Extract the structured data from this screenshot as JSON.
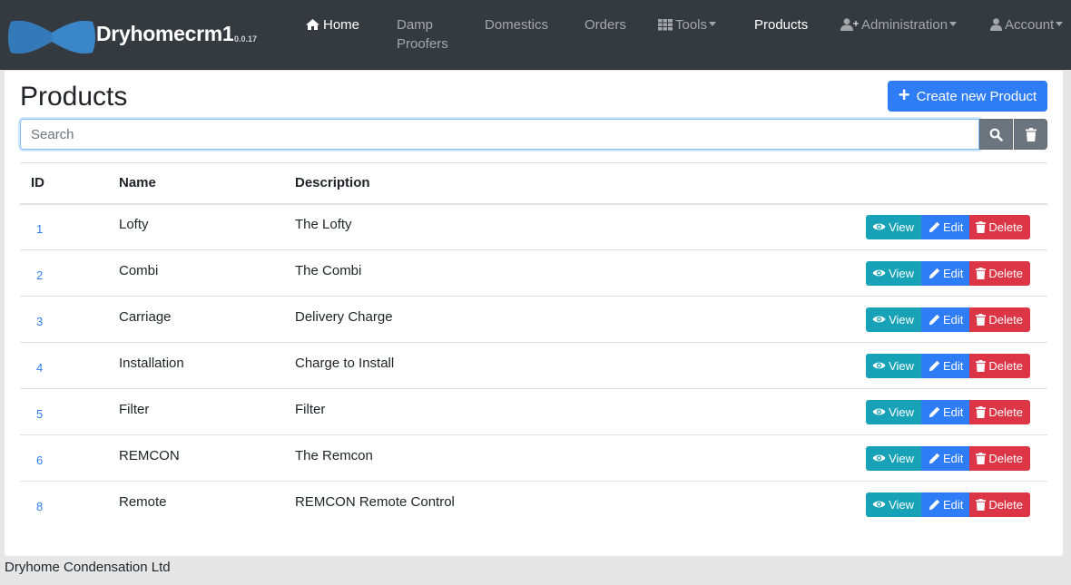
{
  "navbar": {
    "brand_name": "Dryhomecrm1",
    "brand_version": "0.0.17",
    "items": [
      {
        "label": "Home",
        "icon": "home-icon",
        "active": true
      },
      {
        "label": "Damp Proofers"
      },
      {
        "label": "Domestics"
      },
      {
        "label": "Orders"
      },
      {
        "label": "Tools",
        "icon": "table-icon",
        "dropdown": true
      },
      {
        "label": "Products",
        "active": true
      },
      {
        "label": "Administration",
        "icon": "user-plus-icon",
        "dropdown": true
      },
      {
        "label": "Account",
        "icon": "user-icon",
        "dropdown": true
      }
    ],
    "damp_line1": "Damp",
    "damp_line2": "Proofers"
  },
  "page": {
    "title": "Products",
    "create_label": "Create new Product",
    "search_placeholder": "Search"
  },
  "table": {
    "headers": [
      "ID",
      "Name",
      "Description",
      ""
    ],
    "rows": [
      {
        "id": "1",
        "name": "Lofty",
        "description": "The Lofty"
      },
      {
        "id": "2",
        "name": "Combi",
        "description": "The Combi"
      },
      {
        "id": "3",
        "name": "Carriage",
        "description": "Delivery Charge"
      },
      {
        "id": "4",
        "name": "Installation",
        "description": "Charge to Install"
      },
      {
        "id": "5",
        "name": "Filter",
        "description": "Filter"
      },
      {
        "id": "6",
        "name": "REMCON",
        "description": "The Remcon"
      },
      {
        "id": "8",
        "name": "Remote",
        "description": "REMCON Remote Control"
      }
    ],
    "actions": {
      "view": "View",
      "edit": "Edit",
      "delete": "Delete"
    }
  },
  "colors": {
    "navbar": "#343a40",
    "primary": "#2f7df6",
    "info": "#17a2b8",
    "danger": "#dc3545",
    "secondary": "#6c757d"
  },
  "footer": {
    "text": "Dryhome Condensation Ltd"
  }
}
